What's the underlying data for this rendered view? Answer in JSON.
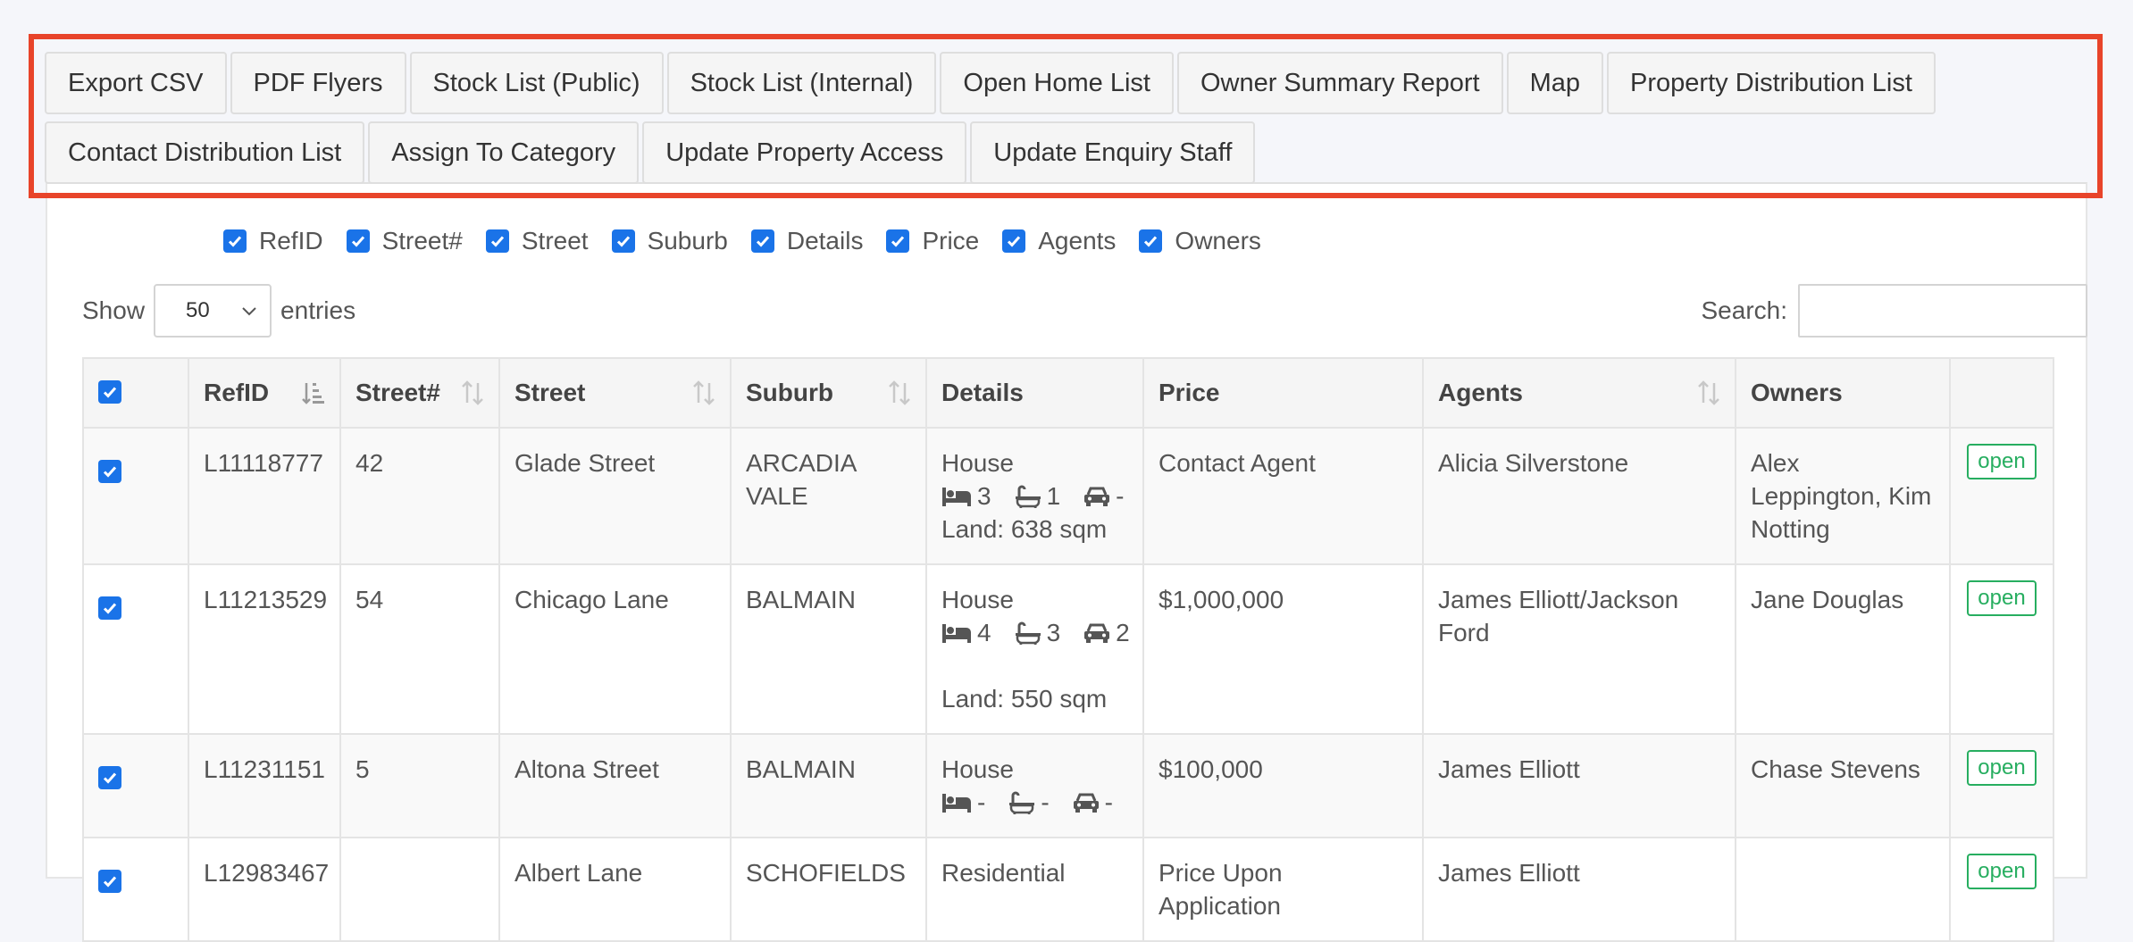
{
  "toolbar": {
    "buttons": [
      "Export CSV",
      "PDF Flyers",
      "Stock List (Public)",
      "Stock List (Internal)",
      "Open Home List",
      "Owner Summary Report",
      "Map",
      "Property Distribution List",
      "Contact Distribution List",
      "Assign To Category",
      "Update Property Access",
      "Update Enquiry Staff"
    ]
  },
  "columns_toggle": [
    "RefID",
    "Street#",
    "Street",
    "Suburb",
    "Details",
    "Price",
    "Agents",
    "Owners"
  ],
  "length": {
    "show_label": "Show",
    "value": "50",
    "entries_label": "entries"
  },
  "search": {
    "label": "Search:",
    "value": ""
  },
  "table": {
    "headers": [
      "RefID",
      "Street#",
      "Street",
      "Suburb",
      "Details",
      "Price",
      "Agents",
      "Owners"
    ],
    "rows": [
      {
        "refid": "L11118777",
        "street_no": "42",
        "street": "Glade Street",
        "suburb": "ARCADIA VALE",
        "type": "House",
        "beds": "3",
        "baths": "1",
        "cars": "-",
        "land": "Land: 638 sqm",
        "price": "Contact Agent",
        "agents": "Alicia Silverstone",
        "owners": "Alex Leppington, Kim Notting",
        "action": "open"
      },
      {
        "refid": "L11213529",
        "street_no": "54",
        "street": "Chicago Lane",
        "suburb": "BALMAIN",
        "type": "House",
        "beds": "4",
        "baths": "3",
        "cars": "2",
        "land": "Land: 550 sqm",
        "price": "$1,000,000",
        "agents": "James Elliott/Jackson Ford",
        "owners": "Jane Douglas",
        "action": "open"
      },
      {
        "refid": "L11231151",
        "street_no": "5",
        "street": "Altona Street",
        "suburb": "BALMAIN",
        "type": "House",
        "beds": "-",
        "baths": "-",
        "cars": "-",
        "land": "",
        "price": "$100,000",
        "agents": "James Elliott",
        "owners": "Chase Stevens",
        "action": "open"
      },
      {
        "refid": "L12983467",
        "street_no": "",
        "street": "Albert Lane",
        "suburb": "SCHOFIELDS",
        "type": "Residential",
        "beds": "",
        "baths": "",
        "cars": "",
        "land": "",
        "price": "Price Upon Application",
        "agents": "James Elliott",
        "owners": "",
        "action": "open"
      }
    ]
  },
  "colors": {
    "highlight": "#e8442a",
    "checkbox": "#1a73e8",
    "open": "#27ae60"
  },
  "icons": {
    "bed": "bed-icon",
    "bath": "bath-icon",
    "car": "car-icon",
    "sort": "sort-icon"
  }
}
